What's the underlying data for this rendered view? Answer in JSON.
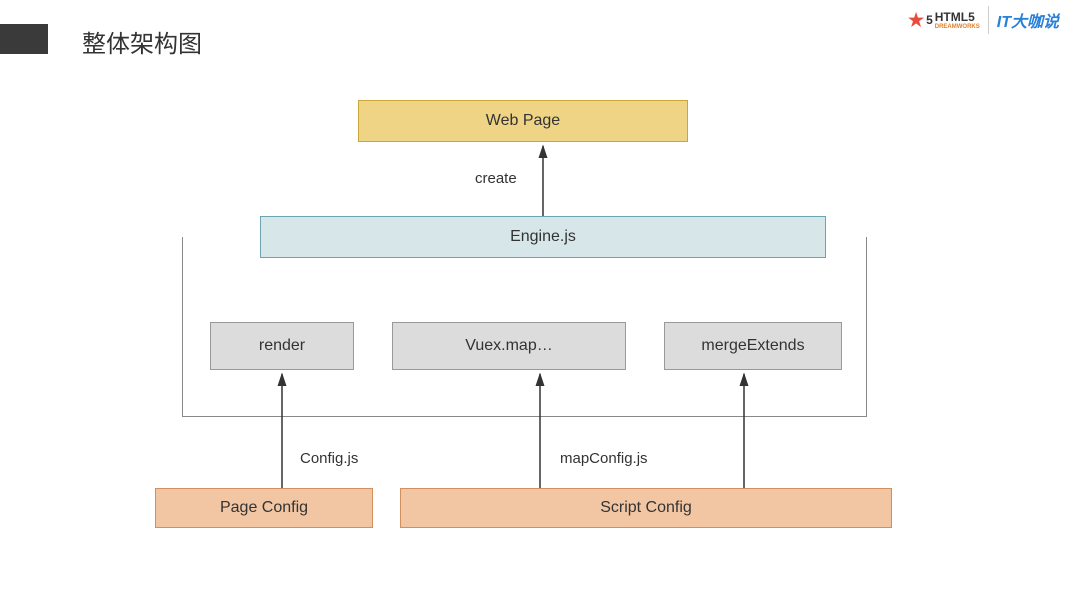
{
  "title": "整体架构图",
  "logos": {
    "html5_prefix": "5",
    "html5_text": "HTML5",
    "html5_sub": "DREAMWORKS",
    "it_text": "IT大咖说"
  },
  "boxes": {
    "webpage": "Web Page",
    "engine": "Engine.js",
    "render": "render",
    "vuex": "Vuex.map…",
    "merge": "mergeExtends",
    "pageconfig": "Page Config",
    "scriptconfig": "Script Config"
  },
  "labels": {
    "create": "create",
    "config": "Config.js",
    "mapconfig": "mapConfig.js"
  }
}
